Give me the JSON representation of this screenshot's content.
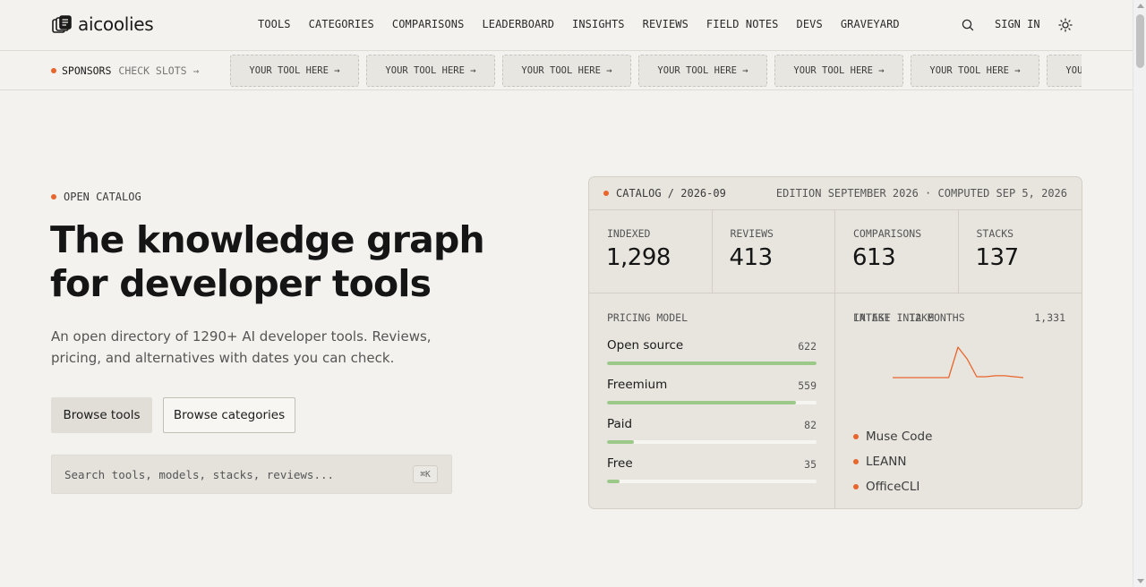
{
  "brand": {
    "name": "aicoolies",
    "logo_icon": "stacked-cards-logo-icon"
  },
  "nav": {
    "items": [
      "TOOLS",
      "CATEGORIES",
      "COMPARISONS",
      "LEADERBOARD",
      "INSIGHTS",
      "REVIEWS",
      "FIELD NOTES",
      "DEVS",
      "GRAVEYARD"
    ],
    "sign_in": "SIGN IN",
    "search_icon": "search-icon",
    "theme_icon": "sun-icon"
  },
  "sponsors": {
    "label": "SPONSORS",
    "check": "CHECK SLOTS →",
    "slots": [
      "YOUR TOOL HERE →",
      "YOUR TOOL HERE →",
      "YOUR TOOL HERE →",
      "YOUR TOOL HERE →",
      "YOUR TOOL HERE →",
      "YOUR TOOL HERE →",
      "YOUR TOOL HERE →"
    ]
  },
  "hero": {
    "eyebrow": "OPEN CATALOG",
    "headline": "The knowledge graph for developer tools",
    "subtitle": "An open directory of 1290+ AI developer tools. Reviews, pricing, and alternatives with dates you can check.",
    "primary_button": "Browse tools",
    "secondary_button": "Browse categories",
    "search_placeholder": "Search tools, models, stacks, reviews...",
    "search_shortcut": "⌘K"
  },
  "catalog": {
    "title": "CATALOG / 2026-09",
    "edition": "EDITION SEPTEMBER 2026 · COMPUTED SEP 5, 2026",
    "stats": [
      {
        "label": "INDEXED",
        "value": "1,298"
      },
      {
        "label": "REVIEWS",
        "value": "413"
      },
      {
        "label": "COMPARISONS",
        "value": "613"
      },
      {
        "label": "STACKS",
        "value": "137"
      }
    ],
    "pricing": {
      "label": "PRICING MODEL",
      "rows": [
        {
          "name": "Open source",
          "count": "622",
          "fill_pct": 100
        },
        {
          "name": "Freemium",
          "count": "559",
          "fill_pct": 90
        },
        {
          "name": "Paid",
          "count": "82",
          "fill_pct": 13
        },
        {
          "name": "Free",
          "count": "35",
          "fill_pct": 6
        }
      ]
    },
    "intake": {
      "label": "INTAKE · 12 MONTHS",
      "total": "1,331",
      "sparkline": [
        0,
        0,
        0,
        0,
        0,
        0,
        0,
        33,
        20,
        1,
        1,
        2,
        2,
        1,
        0
      ]
    },
    "latest": {
      "label": "LATEST INTAKE",
      "items": [
        "Muse Code",
        "LEANN",
        "OfficeCLI"
      ]
    }
  },
  "colors": {
    "accent": "#e8652b",
    "bar_fill": "#9cc98a",
    "background": "#f3f2ee"
  }
}
